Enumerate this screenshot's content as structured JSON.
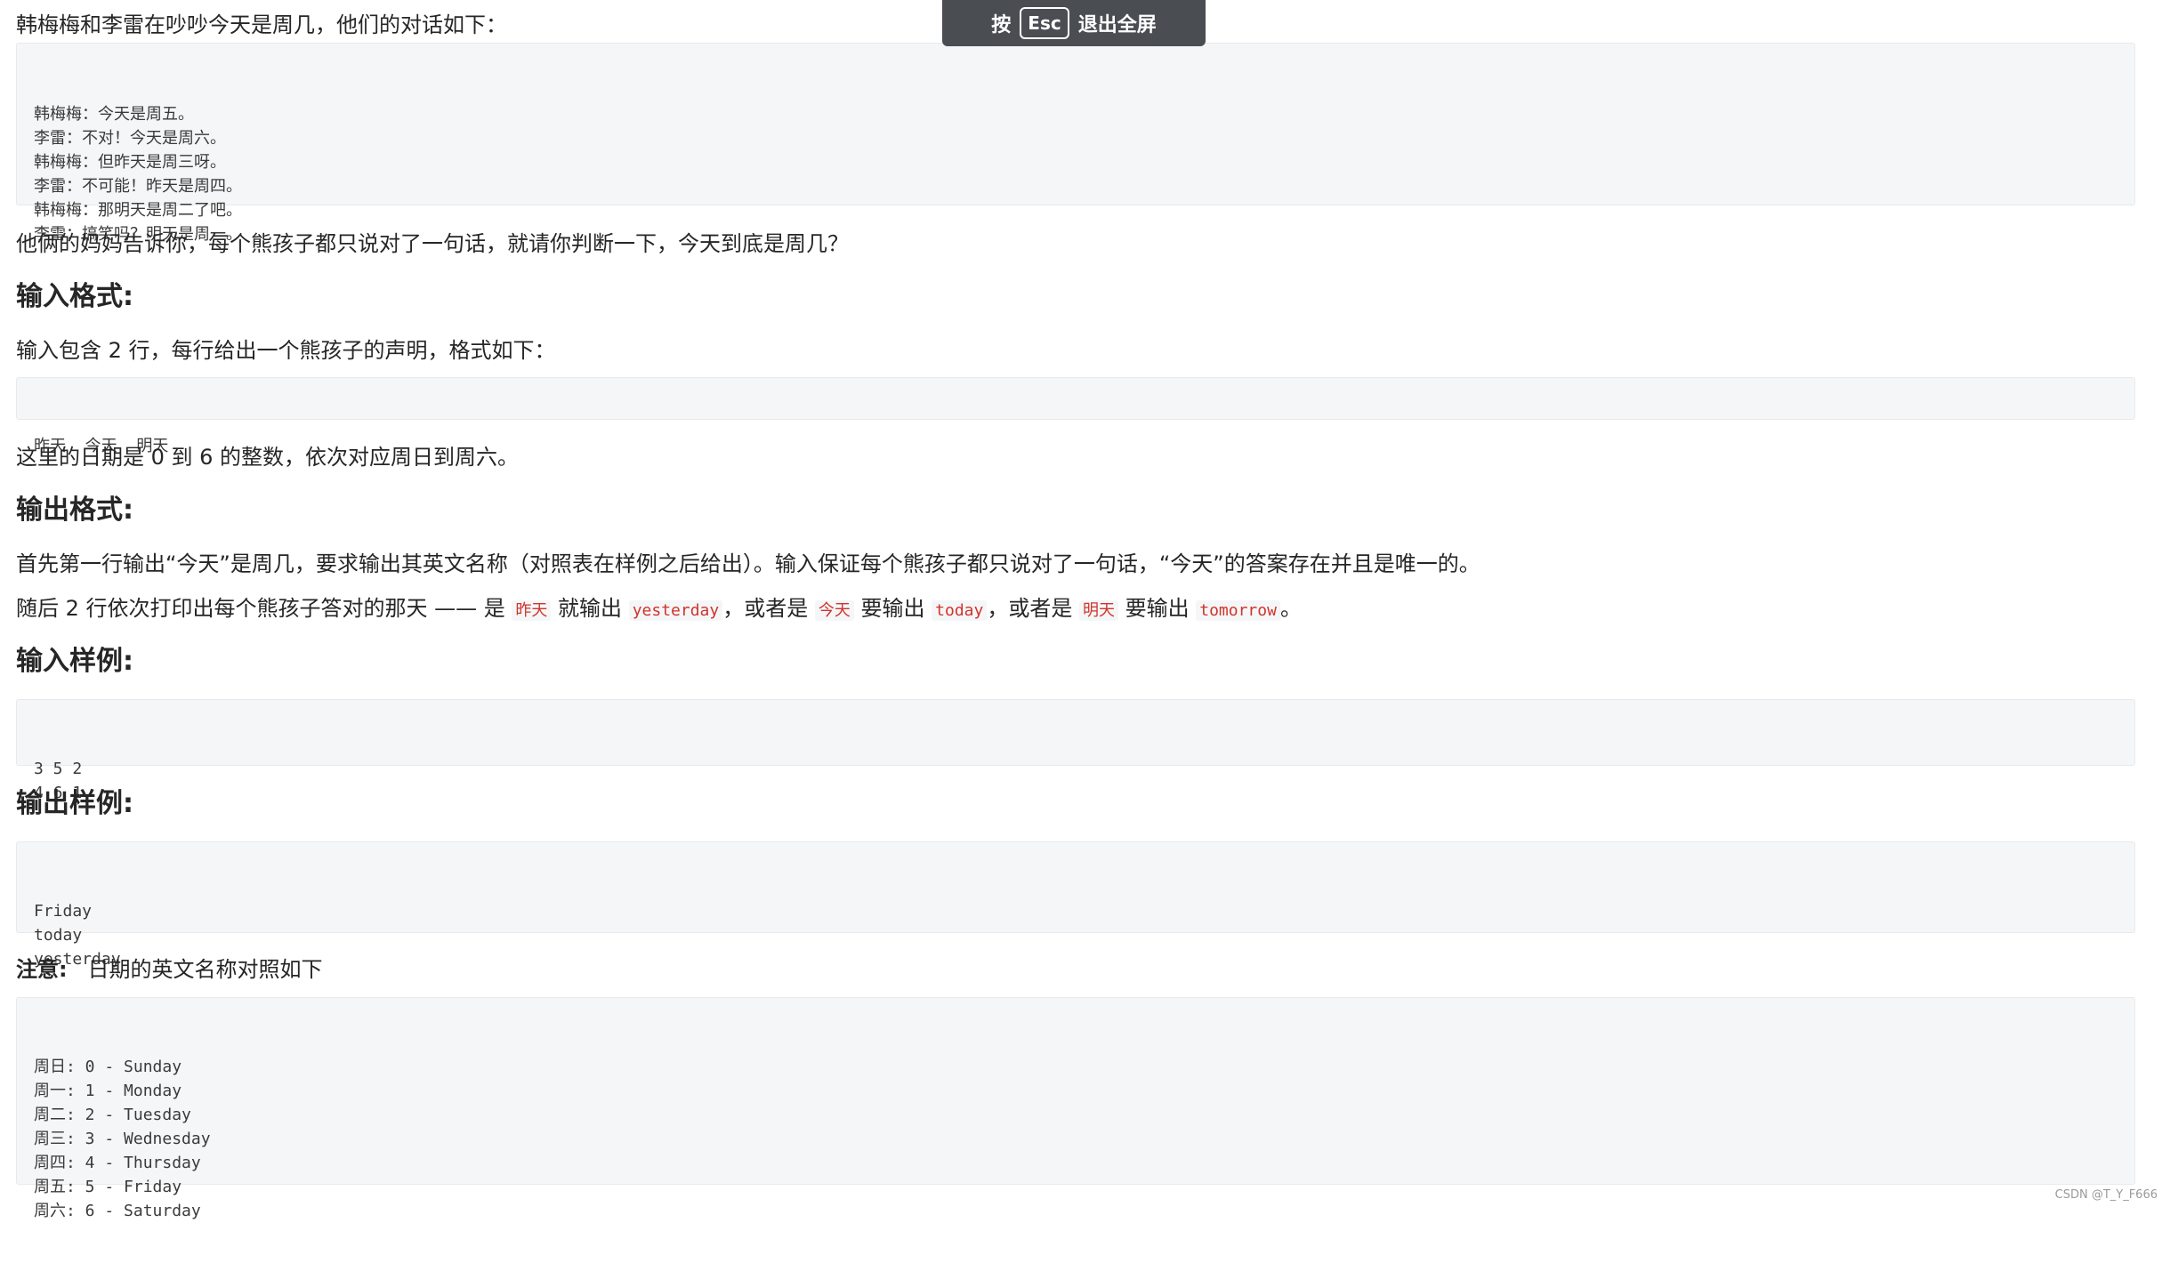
{
  "intro": "韩梅梅和李雷在吵吵今天是周几，他们的对话如下：",
  "dialogue": [
    "韩梅梅：今天是周五。",
    "李雷：不对！今天是周六。",
    "韩梅梅：但昨天是周三呀。",
    "李雷：不可能！昨天是周四。",
    "韩梅梅：那明天是周二了吧。",
    "李雷：搞笑吗？明天是周一。"
  ],
  "question": "他俩的妈妈告诉你，每个熊孩子都只说对了一句话，就请你判断一下，今天到底是周几？",
  "input_heading": "输入格式:",
  "input_desc": "输入包含 2 行，每行给出一个熊孩子的声明，格式如下：",
  "input_format": "昨天  今天  明天",
  "date_desc": "这里的日期是 0 到 6 的整数，依次对应周日到周六。",
  "output_heading": "输出格式:",
  "output_desc1": "首先第一行输出“今天”是周几，要求输出其英文名称（对照表在样例之后给出）。输入保证每个熊孩子都只说对了一句话，“今天”的答案存在并且是唯一的。",
  "output_desc2": {
    "part1": "随后 2 行依次打印出每个熊孩子答对的那天 —— 是 ",
    "code1": "昨天",
    "part2": " 就输出 ",
    "code2": "yesterday",
    "part3": "，或者是 ",
    "code3": "今天",
    "part4": " 要输出 ",
    "code4": "today",
    "part5": "，或者是 ",
    "code5": "明天",
    "part6": " 要输出 ",
    "code6": "tomorrow",
    "part7": "。"
  },
  "sample_input_heading": "输入样例:",
  "sample_input": [
    "3 5 2",
    "4 6 1"
  ],
  "sample_output_heading": "输出样例:",
  "sample_output": [
    "Friday",
    "today",
    "yesterday"
  ],
  "note_label": "注意:",
  "note_text": "日期的英文名称对照如下",
  "day_table": [
    "周日: 0 - Sunday",
    "周一: 1 - Monday",
    "周二: 2 - Tuesday",
    "周三: 3 - Wednesday",
    "周四: 4 - Thursday",
    "周五: 5 - Friday",
    "周六: 6 - Saturday"
  ],
  "esc_overlay": {
    "press": "按",
    "key": "Esc",
    "action": "退出全屏"
  },
  "watermark": "CSDN @T_Y_F666"
}
